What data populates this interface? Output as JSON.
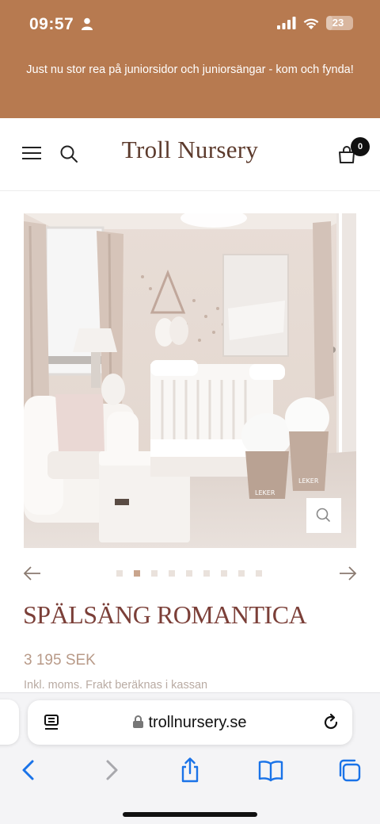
{
  "status": {
    "time": "09:57",
    "battery": "23",
    "battery_level": 0.23
  },
  "announcement": {
    "text": "Just nu stor rea på juniorsidor och juniorsängar - kom och fynda!"
  },
  "header": {
    "logo": "Troll Nursery",
    "cart_count": "0"
  },
  "product": {
    "image_description": "nursery-room-photo",
    "basket_label_1": "LEKER",
    "basket_label_2": "LEKER",
    "gallery_dot_count": 9,
    "gallery_active_index": 1,
    "title": "SPÄLSÄNG ROMANTICA",
    "price": "3 195 SEK",
    "tax_note": "Inkl. moms. Frakt beräknas i kassan"
  },
  "browser": {
    "url": "trollnursery.se"
  },
  "colors": {
    "accent": "#b77a50",
    "title": "#7b3f38",
    "price": "#b89a88",
    "ios_blue": "#1a73e8"
  },
  "icons": {
    "menu": "hamburger-icon",
    "search": "search-icon",
    "cart": "shopping-bag-icon",
    "zoom": "zoom-icon",
    "prev": "arrow-left-icon",
    "next": "arrow-right-icon",
    "reader": "reader-icon",
    "lock": "lock-icon",
    "reload": "reload-icon",
    "back": "back-icon",
    "forward": "forward-icon",
    "share": "share-icon",
    "bookmarks": "bookmarks-icon",
    "tabs": "tabs-icon"
  }
}
